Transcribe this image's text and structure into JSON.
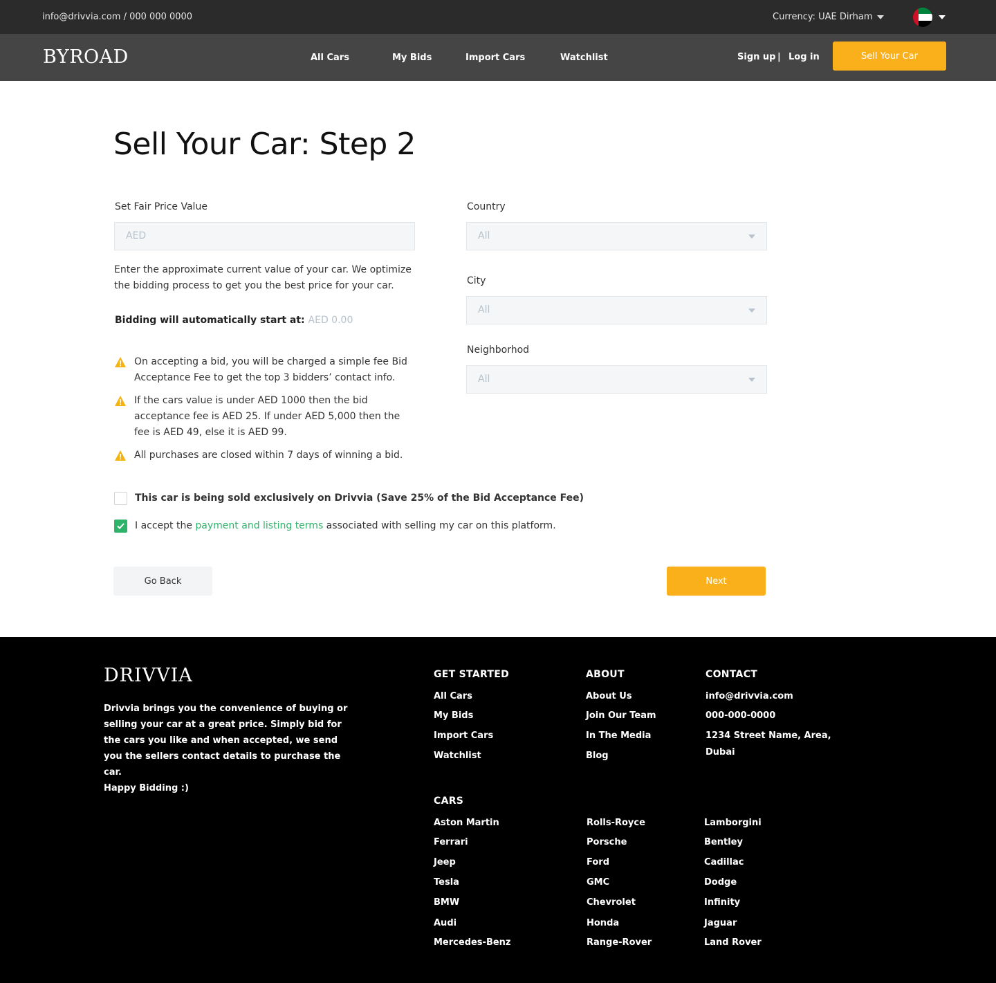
{
  "topbar": {
    "contact": "info@drivvia.com / 000 000 0000",
    "currency": "Currency: UAE Dirham"
  },
  "nav": {
    "logo": "BYROAD",
    "links": [
      "All Cars",
      "My Bids",
      "Import Cars",
      "Watchlist"
    ],
    "signup": "Sign up",
    "separator": "|",
    "login": "Log in",
    "sell_button": "Sell Your Car"
  },
  "form": {
    "title": "Sell Your Car: Step 2",
    "price_label": "Set Fair Price Value",
    "price_placeholder": "AED",
    "price_description": "Enter the approximate current value of your car. We optimize the bidding process to get you the best price for your car.",
    "start_label": "Bidding will automatically start at:",
    "start_value": "AED 0.00",
    "warnings": [
      "On accepting a bid, you will be charged a simple fee Bid Acceptance Fee to get the top 3 bidders’ contact info.",
      "If the cars value is under AED 1000 then the bid acceptance fee is AED 25. If under AED 5,000 then the fee is AED 49, else it is AED 99.",
      "All purchases are closed within 7 days of winning a bid."
    ],
    "country_label": "Country",
    "country_value": "All",
    "city_label": "City",
    "city_value": "All",
    "neighborhood_label": "Neighborhod",
    "neighborhood_value": "All",
    "exclusive_text": "This car is being sold exclusively on Drivvia (Save 25% of the Bid Acceptance Fee)",
    "exclusive_checked": false,
    "terms_prefix": "I accept the ",
    "terms_link": "payment and listing terms",
    "terms_suffix": " associated with selling my car on this platform.",
    "terms_checked": true,
    "back_button": "Go Back",
    "next_button": "Next"
  },
  "footer": {
    "logo": "DRIVVIA",
    "about": "Drivvia brings you the convenience of buying or selling your car at a great price. Simply bid for the cars you like and when accepted, we send you the sellers contact details to purchase the car.",
    "happy": "Happy Bidding :)",
    "get_started": {
      "title": "GET STARTED",
      "links": [
        "All Cars",
        "My Bids",
        "Import Cars",
        "Watchlist"
      ]
    },
    "about_col": {
      "title": "ABOUT",
      "links": [
        "About Us",
        "Join Our Team",
        "In The Media",
        "Blog"
      ]
    },
    "contact": {
      "title": "CONTACT",
      "email": "info@drivvia.com",
      "phone": "000-000-0000",
      "address_line1": "1234 Street Name, Area,",
      "address_line2": "Dubai"
    },
    "cars": {
      "title": "CARS",
      "col1": [
        "Aston Martin",
        "Ferrari",
        "Jeep",
        "Tesla",
        "BMW",
        "Audi",
        "Mercedes-Benz"
      ],
      "col2": [
        "Rolls-Royce",
        "Porsche",
        "Ford",
        "GMC",
        "Chevrolet",
        "Honda",
        "Range-Rover"
      ],
      "col3": [
        "Lamborgini",
        "Bentley",
        "Cadillac",
        "Dodge",
        "Infinity",
        "Jaguar",
        "Land Rover"
      ]
    }
  },
  "colors": {
    "accent": "#f9b01b",
    "success": "#2fb36a",
    "topbar": "#2b2b2b",
    "navbar": "#454545",
    "footer": "#000000"
  }
}
